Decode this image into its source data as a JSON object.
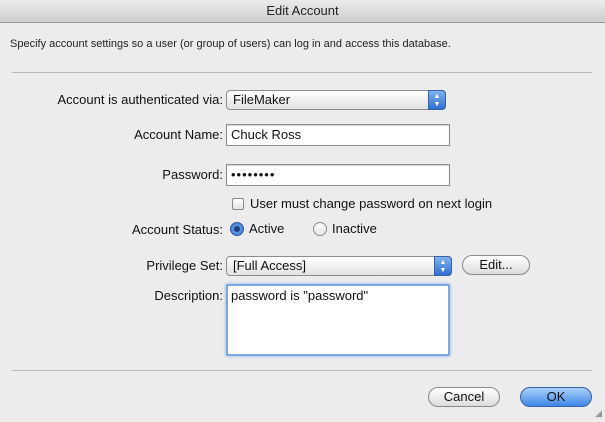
{
  "window": {
    "title": "Edit Account"
  },
  "intro": "Specify account settings so a user (or group of users) can log in and access this database.",
  "auth": {
    "label": "Account is authenticated via:",
    "value": "FileMaker"
  },
  "account_name": {
    "label": "Account Name:",
    "value": "Chuck Ross"
  },
  "password": {
    "label": "Password:",
    "value": "••••••••"
  },
  "must_change": {
    "label": "User must change password on next login",
    "checked": false
  },
  "status": {
    "label": "Account Status:",
    "active": "Active",
    "inactive": "Inactive",
    "selected": "Active"
  },
  "privilege": {
    "label": "Privilege Set:",
    "value": "[Full Access]",
    "edit_label": "Edit..."
  },
  "description": {
    "label": "Description:",
    "value": "password is \"password\""
  },
  "buttons": {
    "cancel": "Cancel",
    "ok": "OK"
  }
}
